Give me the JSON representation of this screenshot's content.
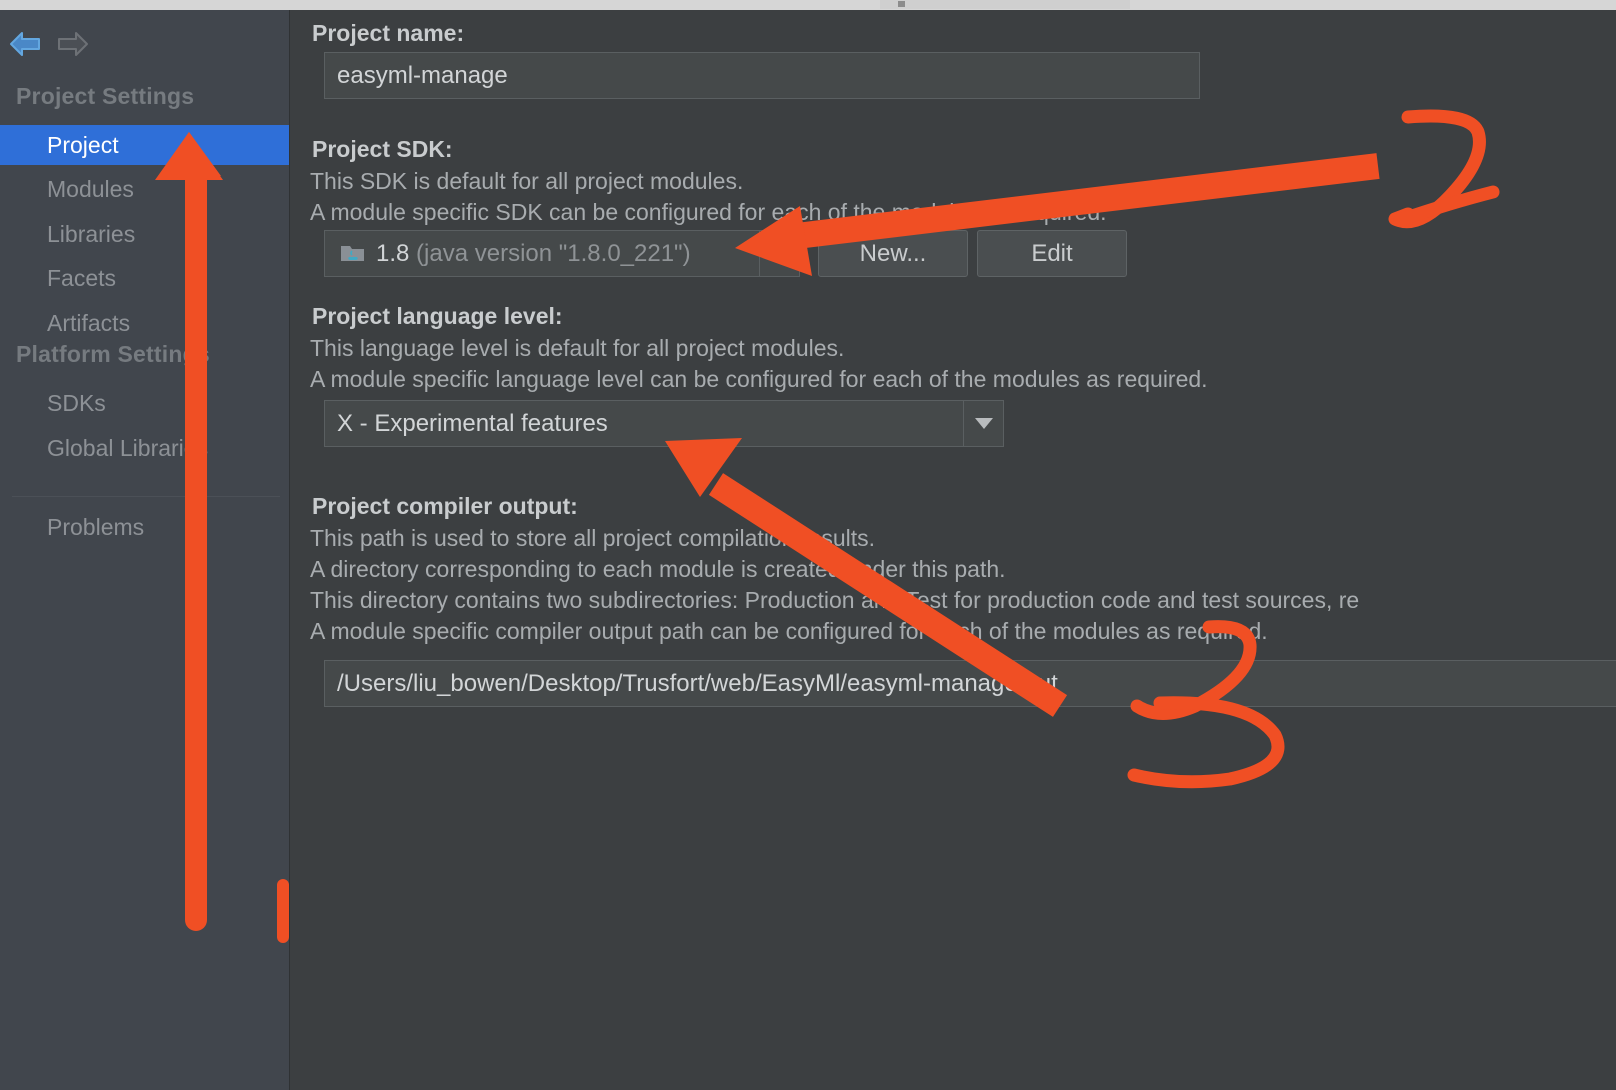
{
  "window": {
    "title_strip": ""
  },
  "sidebar": {
    "nav": {
      "back_icon": "arrow-left-icon",
      "forward_icon": "arrow-right-icon"
    },
    "groups": [
      {
        "header": "Project Settings",
        "items": [
          {
            "label": "Project",
            "selected": true
          },
          {
            "label": "Modules",
            "selected": false
          },
          {
            "label": "Libraries",
            "selected": false
          },
          {
            "label": "Facets",
            "selected": false
          },
          {
            "label": "Artifacts",
            "selected": false
          }
        ]
      },
      {
        "header": "Platform Settings",
        "items": [
          {
            "label": "SDKs",
            "selected": false
          },
          {
            "label": "Global Libraries",
            "selected": false
          }
        ]
      }
    ],
    "footer_items": [
      {
        "label": "Problems",
        "selected": false
      }
    ]
  },
  "main": {
    "project_name": {
      "label": "Project name:",
      "value": "easyml-manage"
    },
    "project_sdk": {
      "label": "Project SDK:",
      "desc_line1": "This SDK is default for all project modules.",
      "desc_line2": "A module specific SDK can be configured for each of the modules as required.",
      "icon": "java-sdk-icon",
      "value_name": "1.8",
      "value_detail": "(java version \"1.8.0_221\")",
      "dropdown_icon": "chevron-down-icon",
      "new_button": "New...",
      "edit_button": "Edit"
    },
    "language_level": {
      "label": "Project language level:",
      "desc_line1": "This language level is default for all project modules.",
      "desc_line2": "A module specific language level can be configured for each of the modules as required.",
      "value": "X - Experimental features",
      "dropdown_icon": "chevron-down-icon"
    },
    "compiler_output": {
      "label": "Project compiler output:",
      "desc_line1": "This path is used to store all project compilation results.",
      "desc_line2": "A directory corresponding to each module is created under this path.",
      "desc_line3": "This directory contains two subdirectories: Production and Test for production code and test sources, re",
      "desc_line4": "A module specific compiler output path can be configured for each of the modules as required.",
      "value": "/Users/liu_bowen/Desktop/Trusfort/web/EasyMl/easyml-manage/out"
    }
  },
  "annotations": {
    "color": "#f04f24",
    "marks": [
      {
        "name": "arrow-to-project-sidebar-item",
        "kind": "arrow"
      },
      {
        "name": "arrow-to-project-sdk",
        "kind": "arrow"
      },
      {
        "name": "handwritten-number-2",
        "kind": "digit",
        "text": "2"
      },
      {
        "name": "arrow-to-language-level",
        "kind": "arrow"
      },
      {
        "name": "handwritten-number-3",
        "kind": "digit",
        "text": "3"
      },
      {
        "name": "vertical-tick-mark",
        "kind": "stroke"
      }
    ]
  },
  "colors": {
    "panel_bg": "#3c3f41",
    "sidebar_bg": "#41464d",
    "selection_blue": "#2f6fd8",
    "field_bg": "#45494a",
    "text_primary": "#c9ccce",
    "text_secondary": "#8d9196",
    "annotation_orange": "#f04f24"
  }
}
